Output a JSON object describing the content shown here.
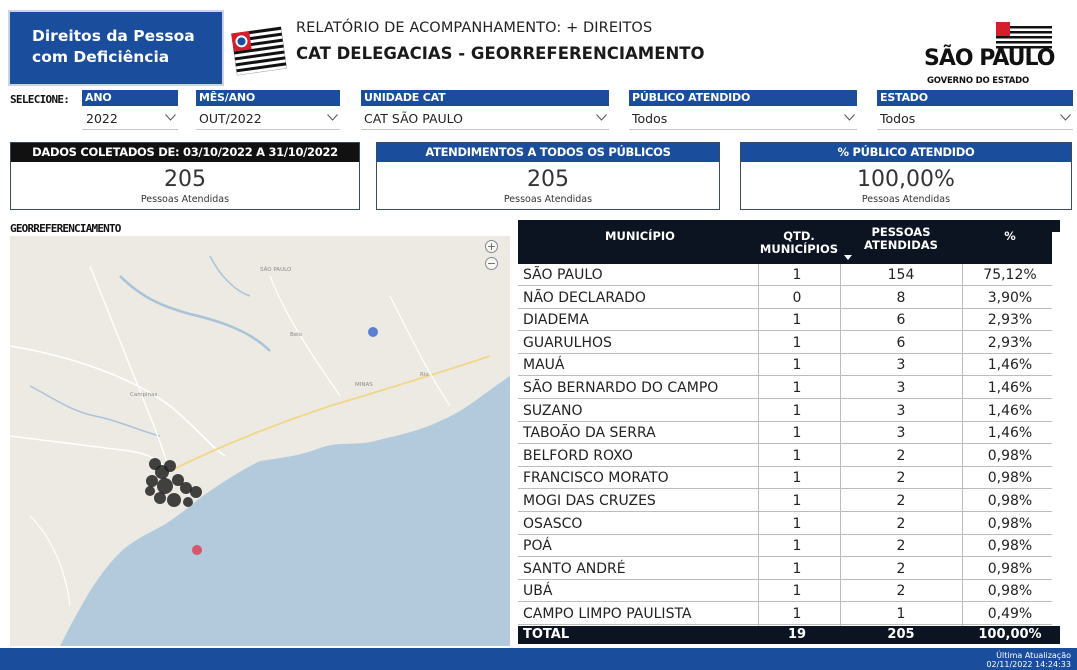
{
  "header": {
    "brand_line1": "Direitos da Pessoa",
    "brand_line2": "com Deficiência",
    "report_subtitle": "RELATÓRIO DE ACOMPANHAMENTO: + DIREITOS",
    "report_title": "CAT DELEGACIAS - GEORREFERENCIAMENTO",
    "logo_name": "SÃO PAULO",
    "logo_sub": "GOVERNO DO ESTADO"
  },
  "filters": {
    "select_label": "SELECIONE:",
    "ano": {
      "label": "ANO",
      "value": "2022"
    },
    "mes_ano": {
      "label": "MÊS/ANO",
      "value": "OUT/2022"
    },
    "unidade": {
      "label": "UNIDADE CAT",
      "value": "CAT SÃO PAULO"
    },
    "publico": {
      "label": "PÚBLICO ATENDIDO",
      "value": "Todos"
    },
    "estado": {
      "label": "ESTADO",
      "value": "Todos"
    }
  },
  "kpis": [
    {
      "title": "DADOS COLETADOS DE: 03/10/2022 A 31/10/2022",
      "value": "205",
      "caption": "Pessoas Atendidas",
      "color": "#111111"
    },
    {
      "title": "ATENDIMENTOS A TODOS OS PÚBLICOS",
      "value": "205",
      "caption": "Pessoas Atendidas",
      "color": "#1a4d9c"
    },
    {
      "title": "% PÚBLICO ATENDIDO",
      "value": "100,00%",
      "caption": "Pessoas Atendidas",
      "color": "#1a4d9c"
    }
  ],
  "map": {
    "title": "GEORREFERENCIAMENTO",
    "zoom_in": "+",
    "zoom_out": "−"
  },
  "table": {
    "headers": {
      "municipio": "MUNICÍPIO",
      "qtd_1": "QTD.",
      "qtd_2": "MUNICÍPIOS",
      "pessoas_1": "PESSOAS",
      "pessoas_2": "ATENDIDAS",
      "pct": "%"
    },
    "rows": [
      {
        "municipio": "SÃO PAULO",
        "qtd": "1",
        "pessoas": "154",
        "pct": "75,12%"
      },
      {
        "municipio": "NÃO DECLARADO",
        "qtd": "0",
        "pessoas": "8",
        "pct": "3,90%"
      },
      {
        "municipio": "DIADEMA",
        "qtd": "1",
        "pessoas": "6",
        "pct": "2,93%"
      },
      {
        "municipio": "GUARULHOS",
        "qtd": "1",
        "pessoas": "6",
        "pct": "2,93%"
      },
      {
        "municipio": "MAUÁ",
        "qtd": "1",
        "pessoas": "3",
        "pct": "1,46%"
      },
      {
        "municipio": "SÃO BERNARDO DO CAMPO",
        "qtd": "1",
        "pessoas": "3",
        "pct": "1,46%"
      },
      {
        "municipio": "SUZANO",
        "qtd": "1",
        "pessoas": "3",
        "pct": "1,46%"
      },
      {
        "municipio": "TABOÃO DA SERRA",
        "qtd": "1",
        "pessoas": "3",
        "pct": "1,46%"
      },
      {
        "municipio": "BELFORD ROXO",
        "qtd": "1",
        "pessoas": "2",
        "pct": "0,98%"
      },
      {
        "municipio": "FRANCISCO MORATO",
        "qtd": "1",
        "pessoas": "2",
        "pct": "0,98%"
      },
      {
        "municipio": "MOGI DAS CRUZES",
        "qtd": "1",
        "pessoas": "2",
        "pct": "0,98%"
      },
      {
        "municipio": "OSASCO",
        "qtd": "1",
        "pessoas": "2",
        "pct": "0,98%"
      },
      {
        "municipio": "POÁ",
        "qtd": "1",
        "pessoas": "2",
        "pct": "0,98%"
      },
      {
        "municipio": "SANTO ANDRÉ",
        "qtd": "1",
        "pessoas": "2",
        "pct": "0,98%"
      },
      {
        "municipio": "UBÁ",
        "qtd": "1",
        "pessoas": "2",
        "pct": "0,98%"
      },
      {
        "municipio": "CAMPO LIMPO PAULISTA",
        "qtd": "1",
        "pessoas": "1",
        "pct": "0,49%"
      }
    ],
    "total": {
      "label": "TOTAL",
      "qtd": "19",
      "pessoas": "205",
      "pct": "100,00%"
    }
  },
  "footer": {
    "updated_label": "Última Atualização",
    "updated_value": "02/11/2022 14:24:33"
  },
  "colors": {
    "brand_blue": "#1a4d9c",
    "table_header": "#0d1421",
    "map_water": "#b3c9dc",
    "map_land": "#eceae3"
  }
}
